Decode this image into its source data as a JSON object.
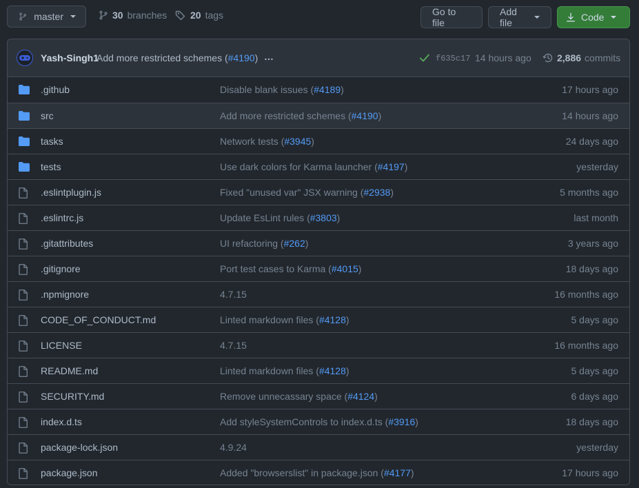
{
  "toolbar": {
    "branch": "master",
    "branches_count": "30",
    "branches_label": "branches",
    "tags_count": "20",
    "tags_label": "tags",
    "goto_file": "Go to file",
    "add_file": "Add file",
    "code": "Code"
  },
  "latest_commit": {
    "author": "Yash-Singh1",
    "message": "Add more restricted schemes (",
    "pr": "#4190",
    "message_end": ")",
    "ellipsis": "…",
    "sha": "f635c17",
    "time": "14 hours ago",
    "commits_count": "2,886",
    "commits_label": "commits"
  },
  "colors": {
    "folder": "#539bf5",
    "file": "#768390",
    "check": "#57ab5a",
    "code_button": "#347d39"
  },
  "files": [
    {
      "type": "folder",
      "name": ".github",
      "msg": "Disable blank issues (",
      "pr": "#4189",
      "msg_end": ")",
      "time": "17 hours ago"
    },
    {
      "type": "folder",
      "name": "src",
      "msg": "Add more restricted schemes (",
      "pr": "#4190",
      "msg_end": ")",
      "time": "14 hours ago"
    },
    {
      "type": "folder",
      "name": "tasks",
      "msg": "Network tests (",
      "pr": "#3945",
      "msg_end": ")",
      "time": "24 days ago"
    },
    {
      "type": "folder",
      "name": "tests",
      "msg": "Use dark colors for Karma launcher (",
      "pr": "#4197",
      "msg_end": ")",
      "time": "yesterday"
    },
    {
      "type": "file",
      "name": ".eslintplugin.js",
      "msg": "Fixed \"unused var\" JSX warning (",
      "pr": "#2938",
      "msg_end": ")",
      "time": "5 months ago"
    },
    {
      "type": "file",
      "name": ".eslintrc.js",
      "msg": "Update EsLint rules (",
      "pr": "#3803",
      "msg_end": ")",
      "time": "last month"
    },
    {
      "type": "file",
      "name": ".gitattributes",
      "msg": "UI refactoring (",
      "pr": "#262",
      "msg_end": ")",
      "time": "3 years ago"
    },
    {
      "type": "file",
      "name": ".gitignore",
      "msg": "Port test cases to Karma (",
      "pr": "#4015",
      "msg_end": ")",
      "time": "18 days ago"
    },
    {
      "type": "file",
      "name": ".npmignore",
      "msg": "4.7.15",
      "pr": "",
      "msg_end": "",
      "time": "16 months ago"
    },
    {
      "type": "file",
      "name": "CODE_OF_CONDUCT.md",
      "msg": "Linted markdown files (",
      "pr": "#4128",
      "msg_end": ")",
      "time": "5 days ago"
    },
    {
      "type": "file",
      "name": "LICENSE",
      "msg": "4.7.15",
      "pr": "",
      "msg_end": "",
      "time": "16 months ago"
    },
    {
      "type": "file",
      "name": "README.md",
      "msg": "Linted markdown files (",
      "pr": "#4128",
      "msg_end": ")",
      "time": "5 days ago"
    },
    {
      "type": "file",
      "name": "SECURITY.md",
      "msg": "Remove unnecassary space (",
      "pr": "#4124",
      "msg_end": ")",
      "time": "6 days ago"
    },
    {
      "type": "file",
      "name": "index.d.ts",
      "msg": "Add styleSystemControls to index.d.ts (",
      "pr": "#3916",
      "msg_end": ")",
      "time": "18 days ago"
    },
    {
      "type": "file",
      "name": "package-lock.json",
      "msg": "4.9.24",
      "pr": "",
      "msg_end": "",
      "time": "yesterday"
    },
    {
      "type": "file",
      "name": "package.json",
      "msg": "Added \"browserslist\" in package.json (",
      "pr": "#4177",
      "msg_end": ")",
      "time": "17 hours ago"
    }
  ]
}
